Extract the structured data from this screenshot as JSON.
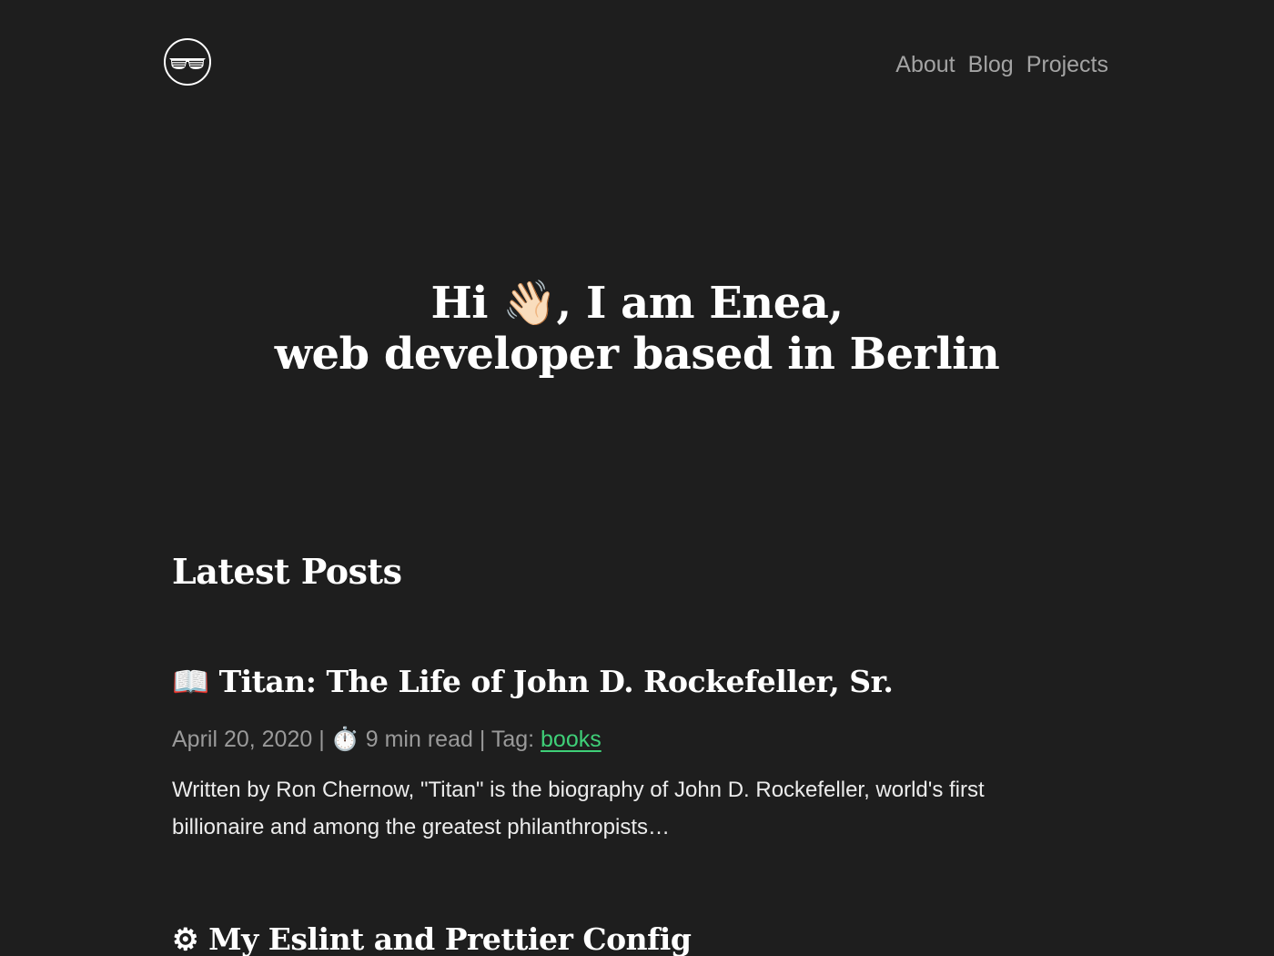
{
  "header": {
    "logo_icon": "sunglasses-logo-icon",
    "nav": [
      {
        "label": "About"
      },
      {
        "label": "Blog"
      },
      {
        "label": "Projects"
      }
    ]
  },
  "hero": {
    "line1": "Hi 👋🏻, I am Enea,",
    "line2": "web developer based in Berlin"
  },
  "latest": {
    "title": "Latest Posts",
    "posts": [
      {
        "title": "📖 Titan: The Life of John D. Rockefeller, Sr.",
        "date": "April 20, 2020",
        "separator1": " | ",
        "read_icon": "⏱️",
        "read_time": " 9 min read",
        "separator2": " | ",
        "tag_prefix": "Tag: ",
        "tag": "books",
        "excerpt": "Written by Ron Chernow, \"Titan\" is the biography of John D. Rockefeller, world's first billionaire and among the greatest philanthropists…"
      },
      {
        "title": "⚙ My Eslint and Prettier Config"
      }
    ]
  },
  "colors": {
    "background": "#1e1e1e",
    "nav_text": "#a3a3a3",
    "meta_text": "#9a9a9a",
    "tag_accent": "#3fcf78",
    "heading": "#ffffff"
  }
}
